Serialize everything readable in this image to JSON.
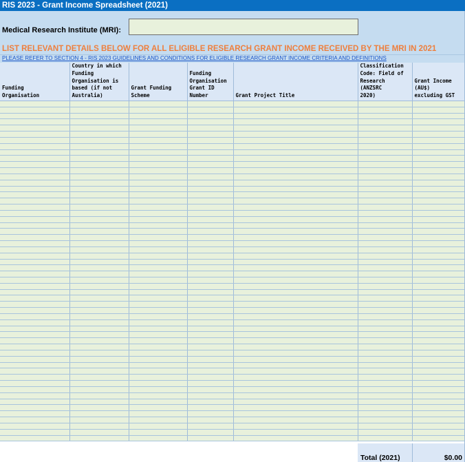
{
  "sheet": {
    "title": "RIS 2023 - Grant Income Spreadsheet (2021)"
  },
  "mri": {
    "label": "Medical Research Institute (MRI):",
    "value": ""
  },
  "instruction": "LIST RELEVANT DETAILS BELOW FOR ALL ELIGIBLE RESEARCH GRANT INCOME RECEIVED BY THE MRI IN 2021",
  "guideline_link": "PLEASE REFER TO SECTION 4 - RIS 2023 GUIDELINES AND CONDITIONS FOR ELIGIBLE RESEARCH GRANT INCOME CRITERIA AND DEFINITIONS",
  "table": {
    "columns": [
      [
        "Funding",
        "Organisation"
      ],
      [
        "Country in which",
        "Funding",
        "Organisation is",
        "based (if not",
        "Australia)"
      ],
      [
        "Grant Funding",
        "Scheme"
      ],
      [
        "Funding",
        "Organisation",
        "Grant ID",
        "Number"
      ],
      [
        "Grant Project Title"
      ],
      [
        "Classification",
        "Code: Field of",
        "Research",
        "(ANZSRC",
        "2020)"
      ],
      [
        "Grant Income",
        "(AU$)",
        "excluding GST"
      ]
    ],
    "rows": 56
  },
  "total": {
    "label": "Total (2021)",
    "value": "$0.00"
  },
  "colors": {
    "title_bar": "#0a6fc2",
    "band": "#c5dcf0",
    "instruction": "#ee7f3d",
    "link": "#1a55c8",
    "entry_cell": "#e8f1dc",
    "header_cell": "#dbe7f6"
  }
}
